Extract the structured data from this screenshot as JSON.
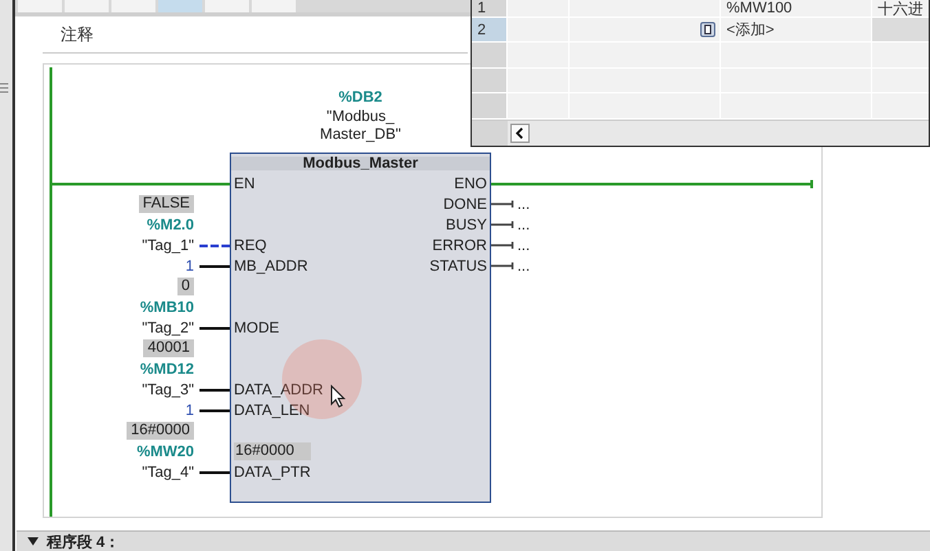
{
  "header_cells": [
    {
      "selected": false
    },
    {
      "selected": false
    },
    {
      "selected": false
    },
    {
      "selected": true
    },
    {
      "selected": false
    },
    {
      "selected": false
    }
  ],
  "comment": "注释",
  "block": {
    "instance_address": "%DB2",
    "instance_name_lines": [
      "\"Modbus_",
      "Master_DB\""
    ],
    "title": "Modbus_Master",
    "inputs": [
      {
        "pin": "EN",
        "power": true
      },
      {
        "pin": "REQ",
        "value": "FALSE",
        "address": "%M2.0",
        "operand": "\"Tag_1\"",
        "kind": "tag",
        "dashed": true
      },
      {
        "pin": "MB_ADDR",
        "operand": "1",
        "kind": "constant",
        "dashed": false
      },
      {
        "pin": "MODE",
        "value": "0",
        "address": "%MB10",
        "operand": "\"Tag_2\"",
        "kind": "tag",
        "dashed": false
      },
      {
        "pin": "DATA_ADDR",
        "value": "40001",
        "address": "%MD12",
        "operand": "\"Tag_3\"",
        "kind": "tag",
        "dashed": false
      },
      {
        "pin": "DATA_LEN",
        "operand": "1",
        "kind": "constant",
        "dashed": false
      },
      {
        "pin": "DATA_PTR",
        "value": "16#0000",
        "address": "%MW20",
        "operand": "\"Tag_4\"",
        "kind": "tag",
        "dashed": false,
        "inner_value": "16#0000"
      }
    ],
    "outputs": [
      {
        "pin": "ENO",
        "power": true
      },
      {
        "pin": "DONE",
        "operand": "..."
      },
      {
        "pin": "BUSY",
        "operand": "..."
      },
      {
        "pin": "ERROR",
        "operand": "..."
      },
      {
        "pin": "STATUS",
        "operand": "..."
      }
    ]
  },
  "tag_table": {
    "rows": [
      {
        "number": "1",
        "address": "%MW100",
        "format": "十六进",
        "selected": false
      },
      {
        "number": "2",
        "placeholder": "<添加>",
        "selected": true
      }
    ]
  },
  "next_network": "程序段 4："
}
